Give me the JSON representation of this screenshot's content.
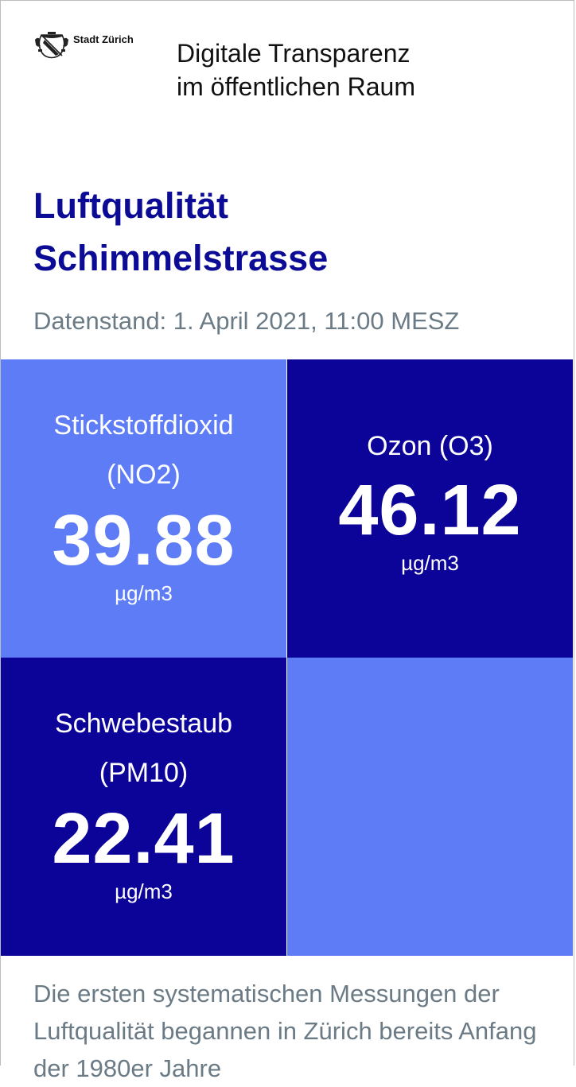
{
  "header": {
    "logo_text": "Stadt Zürich",
    "title_line1": "Digitale Transparenz",
    "title_line2": "im öffentlichen Raum"
  },
  "page": {
    "title_line1": "Luftqualität",
    "title_line2": "Schimmelstrasse",
    "timestamp": "Datenstand: 1. April 2021, 11:00 MESZ"
  },
  "tiles": [
    {
      "label_line1": "Stickstoffdioxid",
      "label_line2": "(NO2)",
      "value": "39.88",
      "unit": "µg/m3"
    },
    {
      "label_line1": "Ozon (O3)",
      "value": "46.12",
      "unit": "µg/m3"
    },
    {
      "label_line1": "Schwebestaub",
      "label_line2": "(PM10)",
      "value": "22.41",
      "unit": "µg/m3"
    }
  ],
  "intro": {
    "text": "Die ersten systematischen Messungen der Luftqualität begannen in Zürich bereits Anfang der 1980er Jahre"
  },
  "colors": {
    "title_blue": "#0b0b96",
    "tile_light": "#5d7cf6",
    "tile_dark": "#0c0399",
    "muted_text": "#6b7b86"
  },
  "icons": {
    "logo": "zurich-coat-of-arms-icon"
  }
}
